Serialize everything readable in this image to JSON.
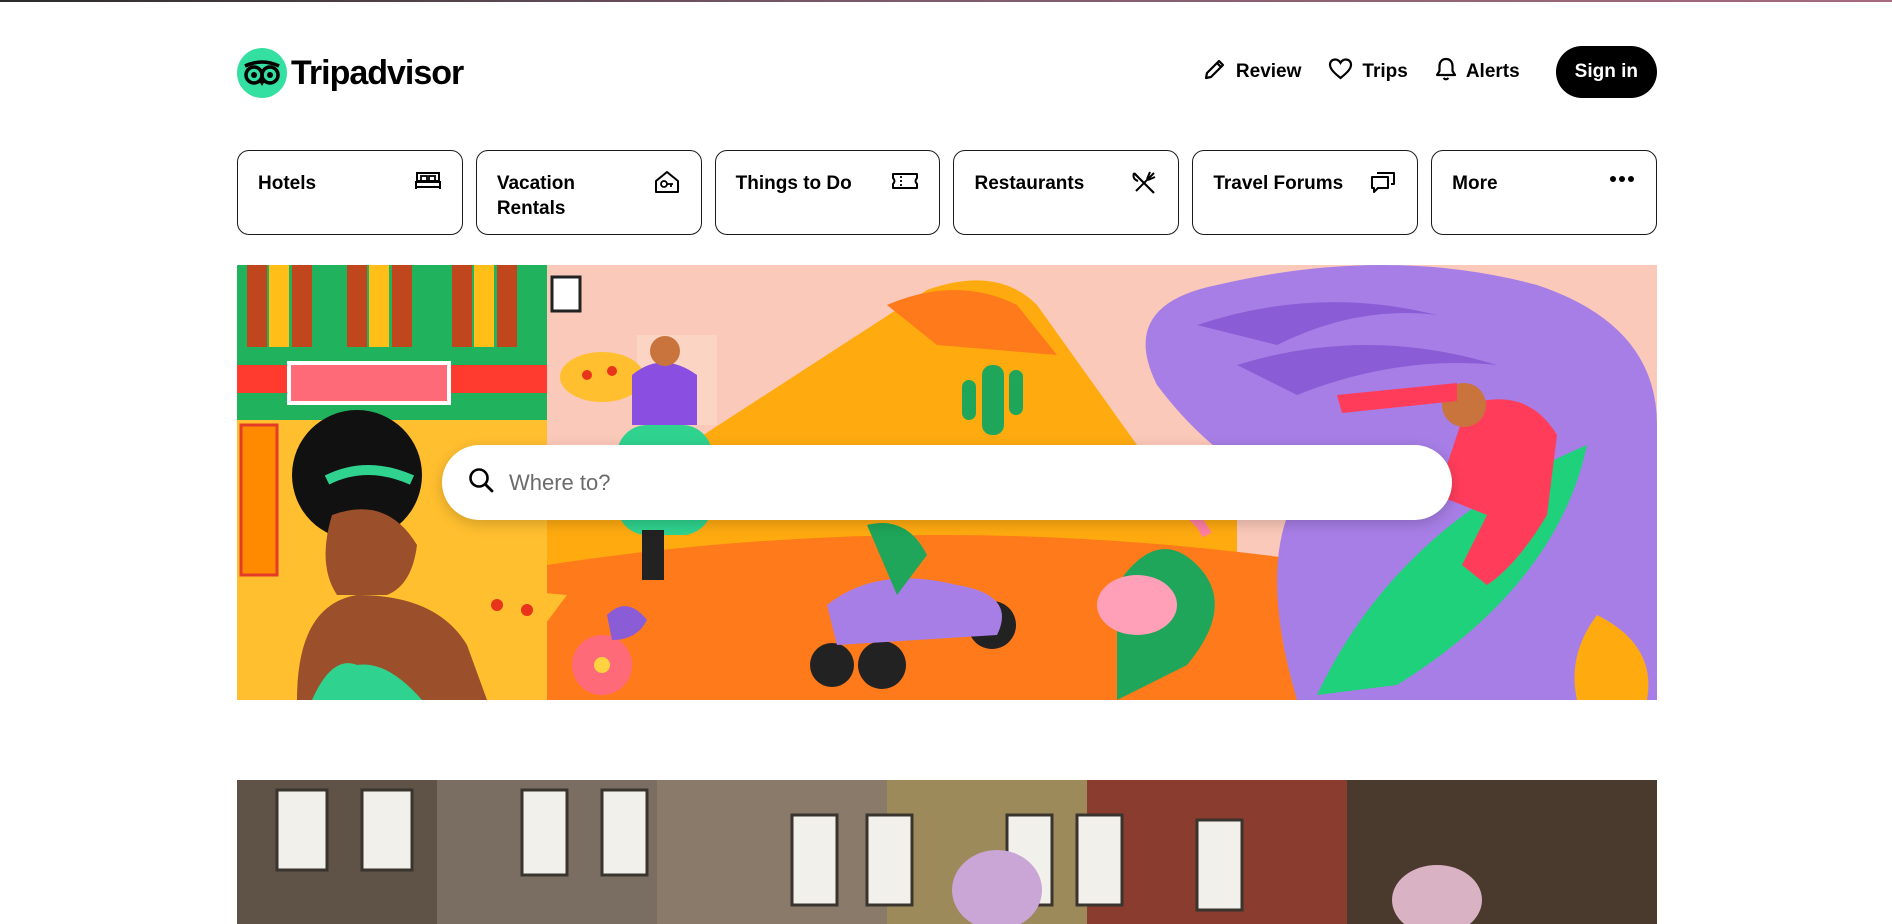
{
  "header": {
    "brand": "Tripadvisor",
    "nav": [
      {
        "label": "Review",
        "icon": "pencil-icon"
      },
      {
        "label": "Trips",
        "icon": "heart-icon"
      },
      {
        "label": "Alerts",
        "icon": "bell-icon"
      }
    ],
    "signin_label": "Sign in"
  },
  "tiles": [
    {
      "label": "Hotels",
      "icon": "bed-icon"
    },
    {
      "label": "Vacation Rentals",
      "icon": "house-key-icon"
    },
    {
      "label": "Things to Do",
      "icon": "ticket-icon"
    },
    {
      "label": "Restaurants",
      "icon": "fork-knife-icon"
    },
    {
      "label": "Travel Forums",
      "icon": "chat-bubbles-icon"
    },
    {
      "label": "More",
      "icon": "more-dots-icon"
    }
  ],
  "search": {
    "placeholder": "Where to?",
    "icon": "search-icon"
  },
  "colors": {
    "brand_green": "#34e0a1",
    "black": "#000000",
    "hero_pink": "#fbd3b7",
    "hero_purple": "#a77ee6",
    "hero_orange": "#ff7a1a"
  }
}
